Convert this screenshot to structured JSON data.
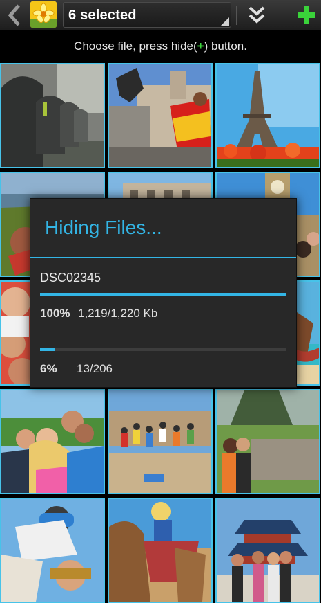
{
  "action_bar": {
    "selection_label": "6 selected",
    "icons": [
      "back-chevron-icon",
      "app-flower-icon",
      "dropdown-triangle-icon",
      "double-chevron-down-icon",
      "plus-icon"
    ],
    "accent_plus": "#3ad23a"
  },
  "instruction": {
    "before": "Choose file, press hide(",
    "symbol": "+",
    "after": ") button."
  },
  "grid": {
    "columns": 3,
    "tiles": [
      "mailboxes",
      "spain-flag-statue",
      "eiffel-tower",
      "coast-grass",
      "city-facade",
      "big-ben-london",
      "friends-circle",
      "blank",
      "beach-hammock",
      "group-selfie",
      "jumping-group",
      "machu-picchu",
      "skydivers",
      "camel-rider",
      "temple-of-heaven"
    ],
    "border_color": "#47c3e9"
  },
  "dialog": {
    "title": "Hiding Files...",
    "file_name": "DSC02345",
    "file_progress": {
      "percent_label": "100%",
      "count_label": "1,219/1,220 Kb",
      "fraction": 1.0
    },
    "total_progress": {
      "percent_label": "6%",
      "count_label": "13/206",
      "fraction": 0.06
    },
    "accent": "#33b5e5"
  }
}
